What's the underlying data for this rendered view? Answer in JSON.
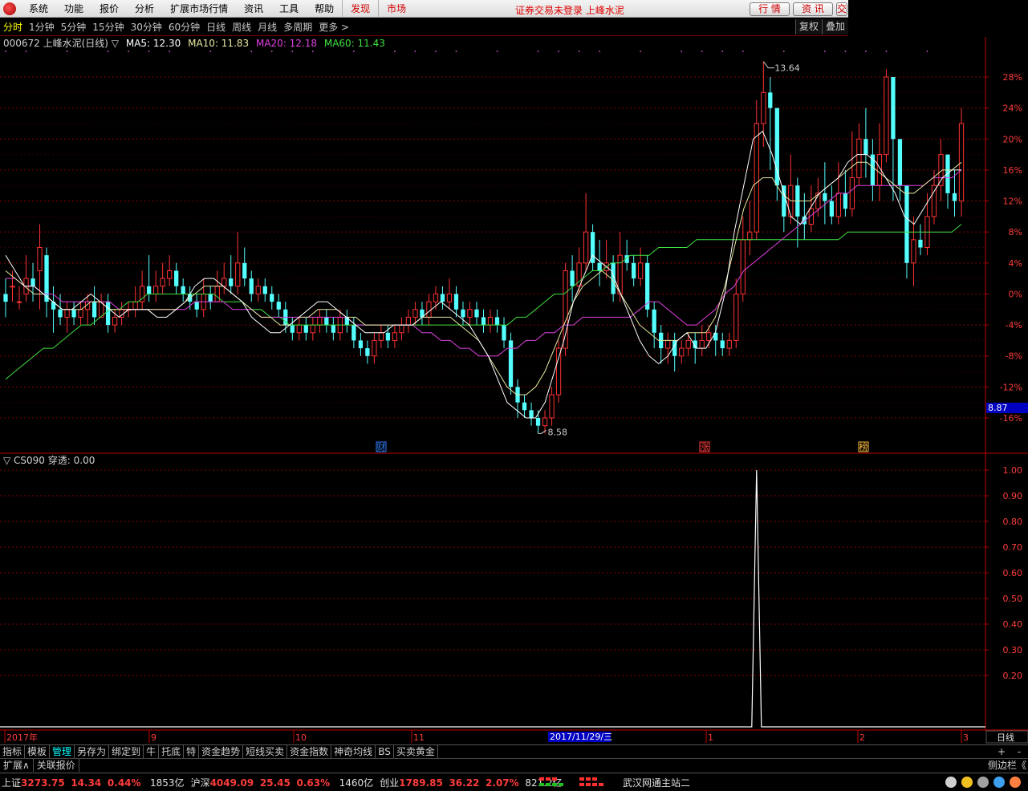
{
  "menu": {
    "items": [
      "系统",
      "功能",
      "报价",
      "分析",
      "扩展市场行情",
      "资讯",
      "工具",
      "帮助"
    ],
    "highlight": [
      "发现",
      "市场"
    ],
    "notice": "证券交易未登录 上峰水泥",
    "buttons": [
      "行 情",
      "资 讯",
      "交"
    ]
  },
  "periods": {
    "items": [
      "分时",
      "1分钟",
      "5分钟",
      "15分钟",
      "30分钟",
      "60分钟",
      "日线",
      "周线",
      "月线",
      "多周期",
      "更多 >"
    ],
    "active": 0,
    "right": [
      "复权",
      "叠加"
    ]
  },
  "chart_title": {
    "stock": "000672 上峰水泥(日线) ▽",
    "ma5": "MA5: 12.30",
    "ma10": "MA10: 11.83",
    "ma20": "MA20: 12.18",
    "ma60": "MA60: 11.43"
  },
  "colors": {
    "up": "#ff3232",
    "down": "#54ffff",
    "ma5": "#ffffff",
    "ma10": "#e8e8a0",
    "ma20": "#e040e0",
    "ma60": "#40e040",
    "axis": "#c00000",
    "grid": "#800000"
  },
  "price_axis": {
    "labels": [
      "28%",
      "24%",
      "20%",
      "16%",
      "12%",
      "8%",
      "4%",
      "0%",
      "-4%",
      "-8%",
      "-12%",
      "-16%"
    ],
    "cursor": "8.87"
  },
  "annotations": {
    "high_label": "13.64",
    "low_label": "8.58",
    "badges": [
      "财",
      "涨",
      "榜"
    ]
  },
  "indicator": {
    "title": "▽ CS090  穿透: 0.00",
    "labels": [
      "1.00",
      "0.90",
      "0.80",
      "0.70",
      "0.60",
      "0.50",
      "0.40",
      "0.30",
      "0.20"
    ]
  },
  "time_axis": {
    "labels": [
      "2017年",
      "9",
      "10",
      "11",
      "1",
      "2",
      "3"
    ],
    "cursor": "2017/11/29/三",
    "period": "日线"
  },
  "tabs": {
    "items": [
      "指标",
      "模板",
      "管理",
      "另存为",
      "绑定到",
      "牛",
      "托底",
      "特",
      "资金趋势",
      "短线买卖",
      "资金指数",
      "神奇均线",
      "BS",
      "买卖黄金"
    ],
    "active": 2,
    "controls": [
      "+",
      "-"
    ]
  },
  "ext": {
    "items": [
      "扩展∧",
      "关联报价"
    ],
    "side": "侧边栏《"
  },
  "status": {
    "sh": {
      "name": "上证",
      "value": "3273.75",
      "chg": "14.34",
      "pct": "0.44%",
      "amt": "1853亿"
    },
    "sz": {
      "name": "沪深",
      "value": "4049.09",
      "chg": "25.45",
      "pct": "0.63%",
      "amt": "1460亿"
    },
    "cy": {
      "name": "创业",
      "value": "1789.85",
      "chg": "36.22",
      "pct": "2.07%",
      "amt": "821.2亿"
    },
    "server": "武汉网通主站二"
  },
  "chart_data": [
    {
      "type": "candlestick",
      "series_note": "",
      "y_axis_labels": [
        "28%",
        "24%",
        "20%",
        "16%",
        "12%",
        "8%",
        "4%",
        "0%",
        "-4%",
        "-8%",
        "-12%",
        "-16%"
      ],
      "x_axis_labels": [
        "2017年",
        "9",
        "10",
        "11",
        "1",
        "2",
        "3"
      ],
      "high": 13.64,
      "low": 8.58,
      "last_cursor_price": 8.87,
      "ma": {
        "MA5": 12.3,
        "MA10": 11.83,
        "MA20": 12.18,
        "MA60": 11.43
      },
      "candles_pct": [
        [
          0,
          -1,
          2,
          -3
        ],
        [
          1,
          1,
          3,
          -1
        ],
        [
          -1,
          -1,
          1,
          -2
        ],
        [
          0,
          2,
          5,
          -1
        ],
        [
          2,
          1,
          4,
          -1
        ],
        [
          3,
          6,
          9,
          -2
        ],
        [
          5,
          -1,
          6,
          -3
        ],
        [
          -1,
          -2,
          1,
          -5
        ],
        [
          -2,
          -3,
          0,
          -4
        ],
        [
          -3,
          -2,
          -1,
          -5
        ],
        [
          -2,
          -3,
          -1,
          -4
        ],
        [
          -3,
          -2,
          -1,
          -4
        ],
        [
          -2,
          -1,
          0,
          -4
        ],
        [
          -1,
          -3,
          1,
          -4
        ],
        [
          -3,
          -1,
          0,
          -3
        ],
        [
          -1,
          -4,
          0,
          -5
        ],
        [
          -4,
          -3,
          -2,
          -5
        ],
        [
          -3,
          -2,
          -1,
          -4
        ],
        [
          -2,
          -2,
          -1,
          -3
        ],
        [
          -2,
          -1,
          1,
          -3
        ],
        [
          -1,
          1,
          3,
          -2
        ],
        [
          1,
          0,
          5,
          -1
        ],
        [
          0,
          1,
          3,
          -1
        ],
        [
          1,
          2,
          4,
          0
        ],
        [
          2,
          3,
          5,
          1
        ],
        [
          3,
          1,
          4,
          0
        ],
        [
          1,
          0,
          2,
          -1
        ],
        [
          0,
          -1,
          1,
          -2
        ],
        [
          -1,
          -2,
          0,
          -3
        ],
        [
          -2,
          0,
          2,
          -3
        ],
        [
          0,
          -1,
          1,
          -2
        ],
        [
          -1,
          1,
          3,
          -1
        ],
        [
          1,
          2,
          4,
          0
        ],
        [
          2,
          1,
          5,
          0
        ],
        [
          1,
          4,
          8,
          0
        ],
        [
          4,
          2,
          6,
          1
        ],
        [
          2,
          0,
          3,
          -1
        ],
        [
          0,
          1,
          2,
          -1
        ],
        [
          1,
          0,
          2,
          -1
        ],
        [
          0,
          -1,
          1,
          -2
        ],
        [
          -1,
          -2,
          0,
          -3
        ],
        [
          -2,
          -4,
          -1,
          -5
        ],
        [
          -4,
          -5,
          -3,
          -6
        ],
        [
          -5,
          -4,
          -3,
          -6
        ],
        [
          -4,
          -5,
          -3,
          -6
        ],
        [
          -5,
          -4,
          -3,
          -6
        ],
        [
          -4,
          -3,
          -2,
          -5
        ],
        [
          -3,
          -4,
          -2,
          -5
        ],
        [
          -4,
          -5,
          -3,
          -6
        ],
        [
          -5,
          -3,
          -2,
          -6
        ],
        [
          -3,
          -4,
          -2,
          -5
        ],
        [
          -4,
          -6,
          -3,
          -7
        ],
        [
          -6,
          -7,
          -5,
          -8
        ],
        [
          -7,
          -8,
          -6,
          -9
        ],
        [
          -8,
          -6,
          -5,
          -9
        ],
        [
          -6,
          -5,
          -4,
          -7
        ],
        [
          -5,
          -6,
          -4,
          -7
        ],
        [
          -6,
          -5,
          -4,
          -7
        ],
        [
          -5,
          -4,
          -3,
          -6
        ],
        [
          -4,
          -3,
          -2,
          -5
        ],
        [
          -3,
          -2,
          -1,
          -4
        ],
        [
          -2,
          -3,
          -1,
          -4
        ],
        [
          -3,
          -1,
          0,
          -4
        ],
        [
          -1,
          0,
          1,
          -2
        ],
        [
          0,
          -1,
          1,
          -2
        ],
        [
          -1,
          0,
          2,
          -2
        ],
        [
          0,
          -2,
          1,
          -3
        ],
        [
          -2,
          -3,
          -1,
          -4
        ],
        [
          -3,
          -2,
          -1,
          -4
        ],
        [
          -2,
          -3,
          -1,
          -4
        ],
        [
          -3,
          -4,
          -2,
          -5
        ],
        [
          -4,
          -3,
          -2,
          -5
        ],
        [
          -3,
          -4,
          -2,
          -5
        ],
        [
          -4,
          -6,
          -3,
          -7
        ],
        [
          -6,
          -12,
          -5,
          -13
        ],
        [
          -12,
          -14,
          -11,
          -16
        ],
        [
          -14,
          -15,
          -13,
          -16
        ],
        [
          -15,
          -16,
          -14,
          -17
        ],
        [
          -16,
          -17,
          -15,
          -18
        ],
        [
          -17,
          -16,
          -15,
          -18
        ],
        [
          -16,
          -13,
          -12,
          -17
        ],
        [
          -13,
          -7,
          -6,
          -14
        ],
        [
          -7,
          3,
          4,
          -8
        ],
        [
          3,
          1,
          5,
          -1
        ],
        [
          1,
          4,
          6,
          0
        ],
        [
          4,
          8,
          13,
          3
        ],
        [
          8,
          4,
          9,
          3
        ],
        [
          4,
          3,
          7,
          1
        ],
        [
          3,
          4,
          7,
          2
        ],
        [
          4,
          0,
          5,
          -1
        ],
        [
          0,
          5,
          8,
          -1
        ],
        [
          5,
          4,
          7,
          3
        ],
        [
          4,
          2,
          5,
          1
        ],
        [
          2,
          4,
          6,
          1
        ],
        [
          4,
          -2,
          5,
          -3
        ],
        [
          -2,
          -5,
          -1,
          -7
        ],
        [
          -5,
          -7,
          -4,
          -9
        ],
        [
          -7,
          -6,
          -5,
          -9
        ],
        [
          -6,
          -8,
          -5,
          -10
        ],
        [
          -8,
          -7,
          -6,
          -9
        ],
        [
          -7,
          -6,
          -5,
          -8
        ],
        [
          -6,
          -7,
          -5,
          -9
        ],
        [
          -7,
          -6,
          -4,
          -8
        ],
        [
          -6,
          -5,
          -4,
          -7
        ],
        [
          -5,
          -6,
          -4,
          -8
        ],
        [
          -6,
          -7,
          -5,
          -8
        ],
        [
          -7,
          -6,
          -5,
          -8
        ],
        [
          -6,
          0,
          2,
          -7
        ],
        [
          0,
          7,
          10,
          -1
        ],
        [
          7,
          8,
          12,
          5
        ],
        [
          8,
          22,
          25,
          7
        ],
        [
          22,
          26,
          30,
          19
        ],
        [
          26,
          24,
          28,
          16
        ],
        [
          24,
          14,
          20,
          12
        ],
        [
          14,
          10,
          12,
          8
        ],
        [
          10,
          14,
          18,
          9
        ],
        [
          14,
          10,
          15,
          6
        ],
        [
          10,
          9,
          13,
          7
        ],
        [
          9,
          11,
          14,
          8
        ],
        [
          11,
          13,
          15,
          10
        ],
        [
          13,
          12,
          17,
          9
        ],
        [
          12,
          10,
          14,
          9
        ],
        [
          10,
          13,
          17,
          9
        ],
        [
          13,
          11,
          16,
          10
        ],
        [
          11,
          15,
          21,
          10
        ],
        [
          15,
          20,
          22,
          14
        ],
        [
          20,
          18,
          24,
          15
        ],
        [
          18,
          14,
          20,
          12
        ],
        [
          14,
          18,
          22,
          12
        ],
        [
          18,
          28,
          29,
          17
        ],
        [
          28,
          20,
          24,
          12
        ],
        [
          20,
          14,
          18,
          12
        ],
        [
          14,
          4,
          9,
          2
        ],
        [
          4,
          7,
          10,
          1
        ],
        [
          7,
          6,
          9,
          5
        ],
        [
          6,
          10,
          13,
          5
        ],
        [
          10,
          14,
          16,
          9
        ],
        [
          14,
          18,
          20,
          12
        ],
        [
          18,
          13,
          15,
          11
        ],
        [
          13,
          12,
          16,
          10
        ],
        [
          12,
          22,
          24,
          10
        ]
      ],
      "ma_lines_pct": {
        "MA5": [
          5,
          3,
          1,
          1,
          0,
          -1,
          -2,
          -2,
          -1,
          0,
          -1,
          -2,
          -3,
          -2,
          -2,
          -2,
          -3,
          -3,
          -2,
          -1,
          1,
          2,
          2,
          1,
          0,
          -1,
          -3,
          -4,
          -5,
          -5,
          -4,
          -3,
          -2,
          -1,
          -1,
          -2,
          -3,
          -4,
          -5,
          -5,
          -5,
          -4,
          -4,
          -4,
          -3,
          -2,
          -1,
          -2,
          -3,
          -4,
          -6,
          -8,
          -11,
          -14,
          -15,
          -16,
          -16,
          -14,
          -10,
          -6,
          -1,
          2,
          5,
          4,
          3,
          0,
          -3,
          -6,
          -8,
          -9,
          -8,
          -6,
          -5,
          -7,
          -7,
          -5,
          0,
          8,
          14,
          20,
          21,
          18,
          14,
          10,
          9,
          11,
          13,
          14,
          15,
          17,
          18,
          18,
          17,
          15,
          13,
          10,
          9,
          11,
          13,
          15,
          16,
          16
        ],
        "MA10": [
          3,
          2,
          1,
          0,
          0,
          -1,
          -2,
          -2,
          -2,
          -1,
          -1,
          -2,
          -2,
          -2,
          -2,
          -2,
          -2,
          -2,
          -2,
          -1,
          0,
          1,
          1,
          1,
          0,
          -1,
          -2,
          -3,
          -3,
          -4,
          -4,
          -3,
          -3,
          -2,
          -2,
          -2,
          -3,
          -3,
          -4,
          -4,
          -4,
          -4,
          -4,
          -4,
          -3,
          -3,
          -3,
          -3,
          -4,
          -5,
          -6,
          -8,
          -10,
          -12,
          -13,
          -13,
          -12,
          -10,
          -7,
          -4,
          -1,
          1,
          2,
          3,
          2,
          0,
          -2,
          -4,
          -5,
          -6,
          -6,
          -6,
          -5,
          -5,
          -5,
          -3,
          1,
          6,
          11,
          14,
          15,
          15,
          13,
          12,
          12,
          12,
          13,
          14,
          15,
          16,
          17,
          17,
          16,
          15,
          14,
          13,
          13,
          14,
          15,
          16,
          16,
          17
        ],
        "MA20": [
          2,
          2,
          1,
          1,
          0,
          0,
          -1,
          -1,
          -1,
          -1,
          -1,
          -1,
          -2,
          -2,
          -2,
          -2,
          -2,
          -2,
          -2,
          -2,
          -1,
          -1,
          -1,
          -1,
          -2,
          -2,
          -2,
          -3,
          -3,
          -3,
          -3,
          -3,
          -3,
          -3,
          -3,
          -3,
          -3,
          -4,
          -4,
          -4,
          -4,
          -4,
          -4,
          -4,
          -5,
          -5,
          -6,
          -6,
          -7,
          -7,
          -8,
          -8,
          -8,
          -7,
          -7,
          -6,
          -6,
          -5,
          -5,
          -4,
          -4,
          -3,
          -3,
          -3,
          -3,
          -3,
          -3,
          -2,
          -1,
          -1,
          -2,
          -3,
          -4,
          -4,
          -3,
          -2,
          0,
          1,
          3,
          4,
          5,
          6,
          7,
          8,
          9,
          10,
          11,
          12,
          13,
          13,
          14,
          14,
          14,
          14,
          14,
          14,
          14,
          14,
          15,
          15,
          15,
          16
        ],
        "MA60": [
          -11,
          -10,
          -9,
          -8,
          -7,
          -7,
          -6,
          -5,
          -4,
          -4,
          -3,
          -2,
          -2,
          -1,
          -1,
          0,
          0,
          0,
          0,
          0,
          0,
          0,
          0,
          -1,
          -1,
          -1,
          -2,
          -2,
          -3,
          -3,
          -4,
          -4,
          -4,
          -4,
          -4,
          -4,
          -4,
          -4,
          -4,
          -4,
          -4,
          -4,
          -4,
          -4,
          -4,
          -4,
          -4,
          -4,
          -4,
          -4,
          -4,
          -4,
          -4,
          -4,
          -3,
          -3,
          -2,
          -1,
          0,
          0,
          1,
          2,
          3,
          3,
          4,
          4,
          5,
          5,
          5,
          6,
          6,
          6,
          6,
          7,
          7,
          7,
          7,
          7,
          7,
          7,
          7,
          7,
          7,
          7,
          7,
          7,
          7,
          7,
          7,
          8,
          8,
          8,
          8,
          8,
          8,
          8,
          8,
          8,
          8,
          8,
          8,
          9
        ]
      }
    },
    {
      "type": "line",
      "series_note": "",
      "y_axis_labels": [
        "1.00",
        "0.90",
        "0.80",
        "0.70",
        "0.60",
        "0.50",
        "0.40",
        "0.30",
        "0.20"
      ],
      "spike_index": 110,
      "spike_value": 1.0,
      "baseline": 0.0
    }
  ]
}
